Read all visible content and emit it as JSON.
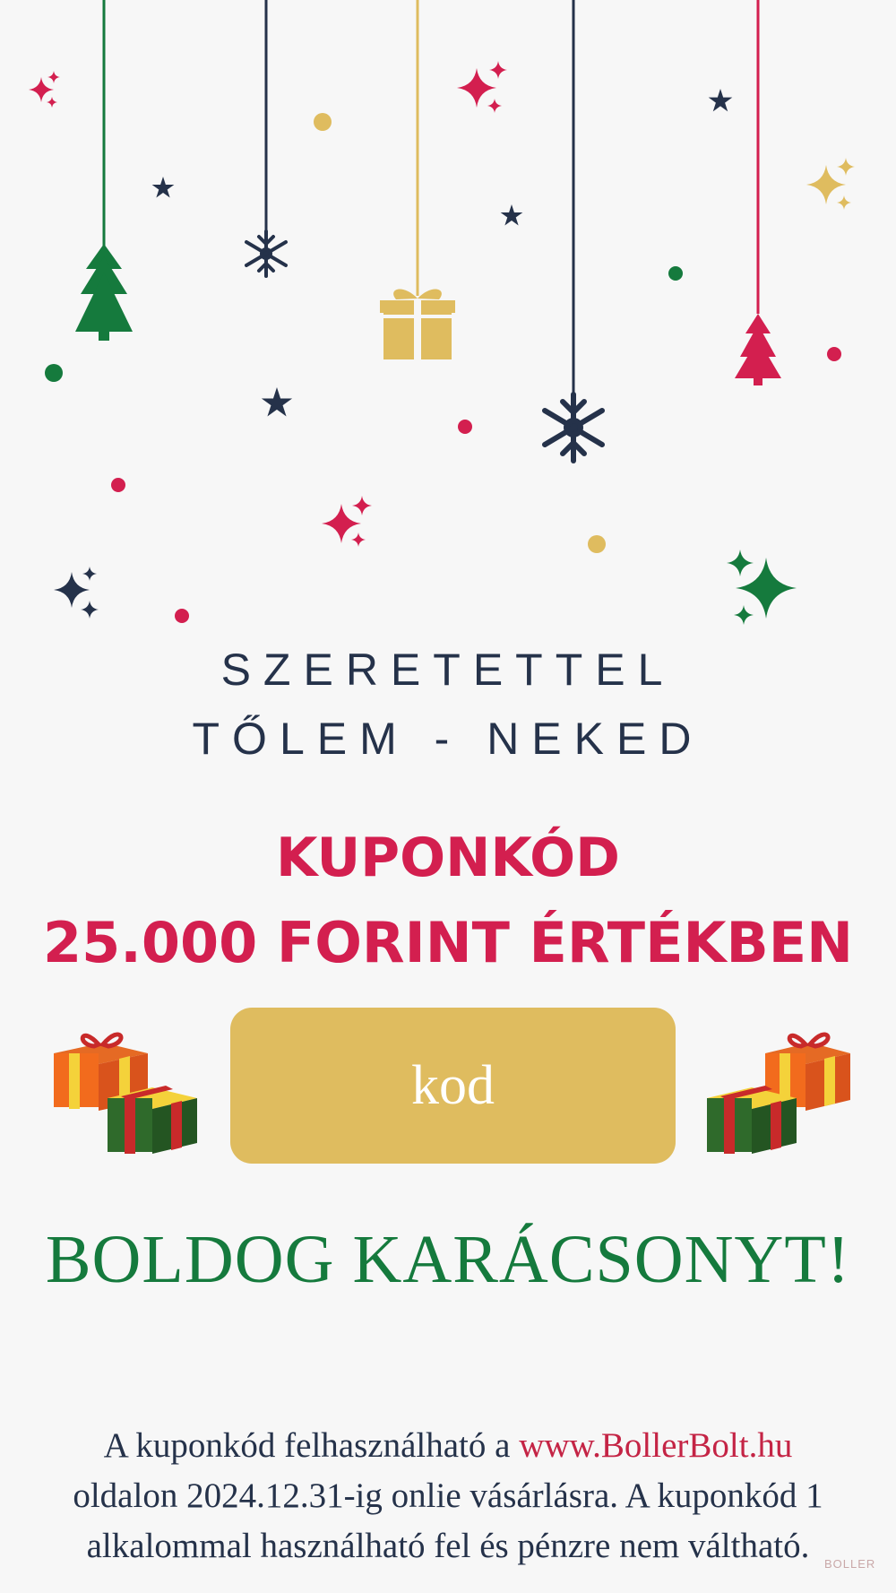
{
  "greeting": {
    "line1": "SZERETETTEL",
    "line2": "TŐLEM - NEKED"
  },
  "headline": {
    "line1": "KUPONKÓD",
    "line2": "25.000 FORINT ÉRTÉKBEN"
  },
  "coupon": {
    "code": "kod"
  },
  "closing": "BOLDOG KARÁCSONYT!",
  "footer": {
    "pre": "A kuponkód felhasználható a ",
    "link": "www.BollerBolt.hu",
    "line2": "oldalon 2024.12.31-ig onlie vásárlásra.  A kuponkód 1",
    "line3": "alkalommal használható fel és pénzre nem váltható."
  },
  "watermark": "BOLLER",
  "colors": {
    "green": "#157a3d",
    "red": "#d31f4f",
    "navy": "#25324a",
    "gold": "#dfbc5f",
    "background": "#f7f7f7"
  },
  "icons": [
    "christmas-tree-icon",
    "snowflake-icon",
    "gift-ornament-icon",
    "star-icon",
    "sparkle-icon",
    "gift-box-icon"
  ]
}
